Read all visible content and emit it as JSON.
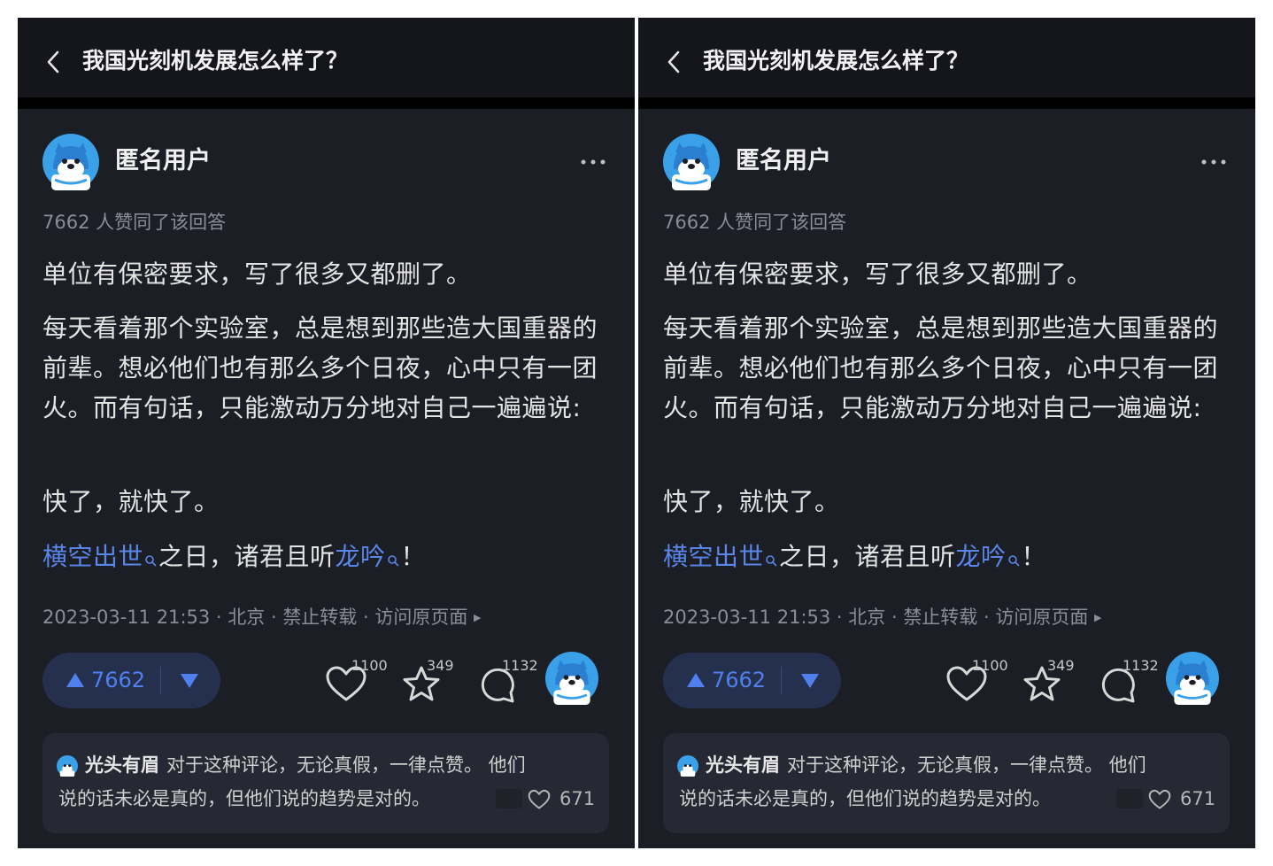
{
  "question_title": "我国光刻机发展怎么样了？",
  "author": {
    "name": "匿名用户"
  },
  "approvals_text": "7662 人赞同了该回答",
  "answer": {
    "p1": "单位有保密要求，写了很多又都删了。",
    "p2": "每天看着那个实验室，总是想到那些造大国重器的前辈。想必他们也有那么多个日夜，心中只有一团火。而有句话，只能激动万分地对自己一遍遍说:",
    "p3": "快了，就快了。",
    "p4": {
      "link1": "横空出世",
      "mid": "之日，诸君且听",
      "link2": "龙吟",
      "end": "！"
    }
  },
  "meta": {
    "datetime": "2023-03-11 21:53",
    "location": "北京",
    "copyright": "禁止转载",
    "view_original": "访问原页面",
    "separator": " · "
  },
  "actions": {
    "upvotes": "7662",
    "likes": "1100",
    "favorites": "349",
    "comments": "1132"
  },
  "top_comment": {
    "author": "光头有眉",
    "line1": "对于这种评论，无论真假，一律点赞。 他们",
    "line2": "说的话未必是真的，但他们说的趋势是对的。",
    "likes": "671"
  },
  "colors": {
    "background": "#1c1e26",
    "header": "#15161c",
    "link": "#5a86ea",
    "vote_pill": "#25304e",
    "vote_accent": "#4f80ee",
    "avatar_blue": "#3aa0e8"
  },
  "icons": [
    "back-arrow-icon",
    "more-dots-icon",
    "upvote-triangle-icon",
    "downvote-triangle-icon",
    "heart-icon",
    "star-icon",
    "comment-bubble-icon",
    "search-icon"
  ]
}
